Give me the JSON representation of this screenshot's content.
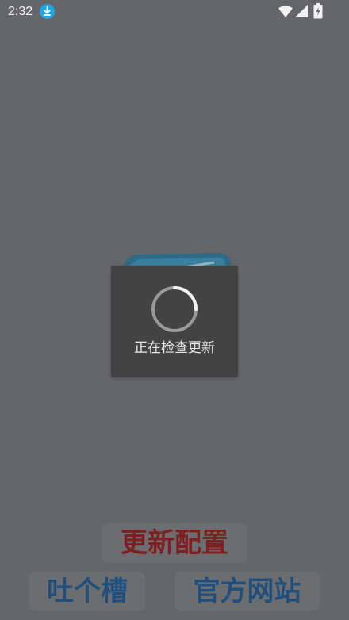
{
  "status_bar": {
    "time": "2:32",
    "icons": [
      "download-icon",
      "wifi-icon",
      "signal-icon",
      "battery-icon"
    ]
  },
  "dialog": {
    "message": "正在检查更新"
  },
  "buttons": {
    "update_config": "更新配置",
    "feedback": "吐个槽",
    "website": "官方网站"
  },
  "colors": {
    "overlay_background": "#65666a",
    "dialog_background": "#434344",
    "update_text": "#7f1f22",
    "link_text": "#1f4f7a",
    "download_badge": "#1ea7e6"
  }
}
